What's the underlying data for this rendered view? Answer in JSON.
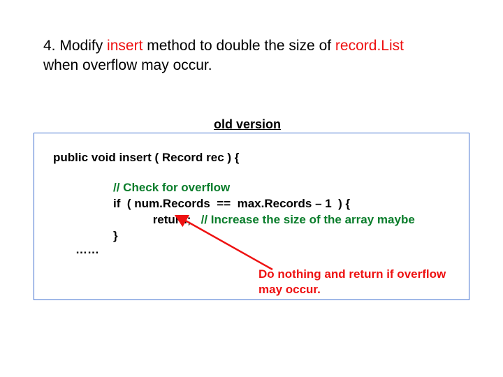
{
  "heading": {
    "prefix": "4. Modify ",
    "insert": "insert",
    "mid": " method to double the size of ",
    "recordList": "record.List",
    "suffix_line2": "when overflow may occur."
  },
  "version_label": "old version",
  "code": {
    "signature": "public void insert ( Record  rec ) {",
    "comment_overflow": "// Check for overflow",
    "if_line": "if  ( num.Records  ==  max.Records – 1  ) {",
    "return_kw": "return;",
    "return_comment": "   // Increase the size of the array maybe",
    "close_brace": "}",
    "ellipsis": "……"
  },
  "annotation": "Do nothing and return if overflow may occur."
}
